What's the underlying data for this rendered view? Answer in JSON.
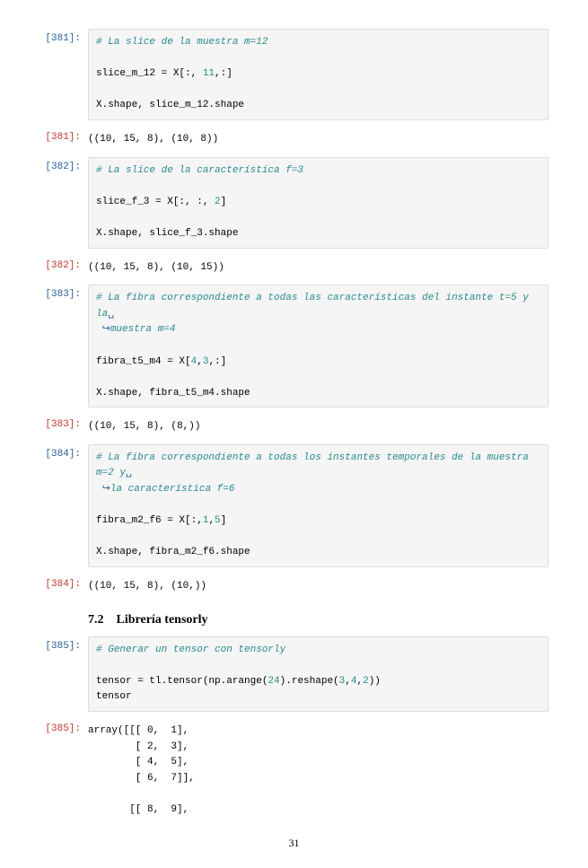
{
  "cells": [
    {
      "id": "381in",
      "kind": "in",
      "label": "[381]:",
      "lineA_comment": "# La slice de la muestra m=12",
      "lineB": "slice_m_12 = X[:, ",
      "lineB_num": "11",
      "lineB_tail": ",:]",
      "lineC": "X.shape, slice_m_12.shape"
    },
    {
      "id": "381out",
      "kind": "out",
      "label": "[381]:",
      "text": "((10, 15, 8), (10, 8))"
    },
    {
      "id": "382in",
      "kind": "in",
      "label": "[382]:",
      "lineA_comment": "# La slice de la característica f=3",
      "lineB": "slice_f_3 = X[:, :, ",
      "lineB_num": "2",
      "lineB_tail": "]",
      "lineC": "X.shape, slice_f_3.shape"
    },
    {
      "id": "382out",
      "kind": "out",
      "label": "[382]:",
      "text": "((10, 15, 8), (10, 15))"
    },
    {
      "id": "383in",
      "kind": "in",
      "label": "[383]:",
      "lineA_comment": "# La fibra correspondiente a todas las características del instante t=5 y la",
      "lineA_wrap_arrow": "↪",
      "lineA_cont_comment": "muestra m=4",
      "lineB": "fibra_t5_m4 = X[",
      "lineB_num": "4",
      "lineB_mid": ",",
      "lineB_num2": "3",
      "lineB_tail": ",:]",
      "lineC": "X.shape, fibra_t5_m4.shape"
    },
    {
      "id": "383out",
      "kind": "out",
      "label": "[383]:",
      "text": "((10, 15, 8), (8,))"
    },
    {
      "id": "384in",
      "kind": "in",
      "label": "[384]:",
      "lineA_comment": "# La fibra correspondiente a todas los instantes temporales de la muestra m=2 y",
      "lineA_wrap_arrow": "↪",
      "lineA_cont_comment": "la característica f=6",
      "lineB": "fibra_m2_f6 = X[:,",
      "lineB_num": "1",
      "lineB_mid": ",",
      "lineB_num2": "5",
      "lineB_tail": "]",
      "lineC": "X.shape, fibra_m2_f6.shape"
    },
    {
      "id": "384out",
      "kind": "out",
      "label": "[384]:",
      "text": "((10, 15, 8), (10,))"
    }
  ],
  "section": {
    "num": "7.2",
    "title": "Librería tensorly"
  },
  "cell385in": {
    "label": "[385]:",
    "lineA_comment": "# Generar un tensor con tensorly",
    "lineB_pre": "tensor = tl.tensor(np.arange(",
    "lineB_n1": "24",
    "lineB_mid1": ").reshape(",
    "lineB_n2": "3",
    "lineB_mid2": ",",
    "lineB_n3": "4",
    "lineB_mid3": ",",
    "lineB_n4": "2",
    "lineB_tail": "))",
    "lineC": "tensor"
  },
  "cell385out": {
    "label": "[385]:",
    "text": "array([[[ 0,  1],\n        [ 2,  3],\n        [ 4,  5],\n        [ 6,  7]],\n\n       [[ 8,  9],"
  },
  "page_number": "31",
  "wrap_trail": "␣"
}
